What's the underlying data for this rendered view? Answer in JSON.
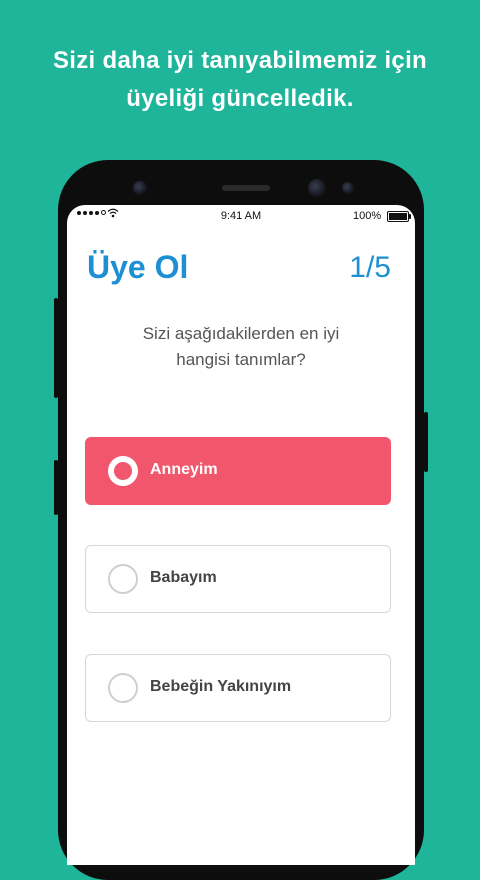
{
  "headline": {
    "line1": "Sizi daha iyi tanıyabilmemiz için",
    "line2": "üyeliği güncelledik."
  },
  "status_bar": {
    "time": "9:41 AM",
    "battery": "100%",
    "icons": [
      "signal-dots-icon",
      "wifi-icon",
      "battery-icon"
    ]
  },
  "screen": {
    "title": "Üye Ol",
    "step": "1/5",
    "question_line1": "Sizi aşağıdakilerden en iyi",
    "question_line2": "hangisi tanımlar?",
    "options": [
      {
        "label": "Anneyim",
        "selected": true
      },
      {
        "label": "Babayım",
        "selected": false
      },
      {
        "label": "Bebeğin Yakınıyım",
        "selected": false
      }
    ]
  },
  "colors": {
    "background": "#1fb59a",
    "title_blue": "#1d8fd4",
    "selected_option": "#f2566d"
  }
}
